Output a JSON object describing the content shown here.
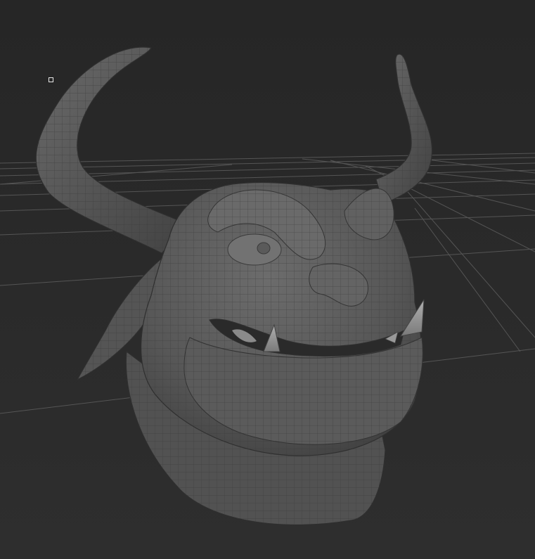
{
  "viewport": {
    "background_top": "#262626",
    "background_bottom": "#2e2e2e",
    "grid_color": "#5a5a5a",
    "grid_visible": true
  },
  "model": {
    "type": "horned-creature-head",
    "display": "wireframe-on-shaded",
    "mesh_color": "#5c5c5c",
    "wire_color": "#3a3a3a"
  },
  "cursor": {
    "icon": "pivot-marker"
  }
}
